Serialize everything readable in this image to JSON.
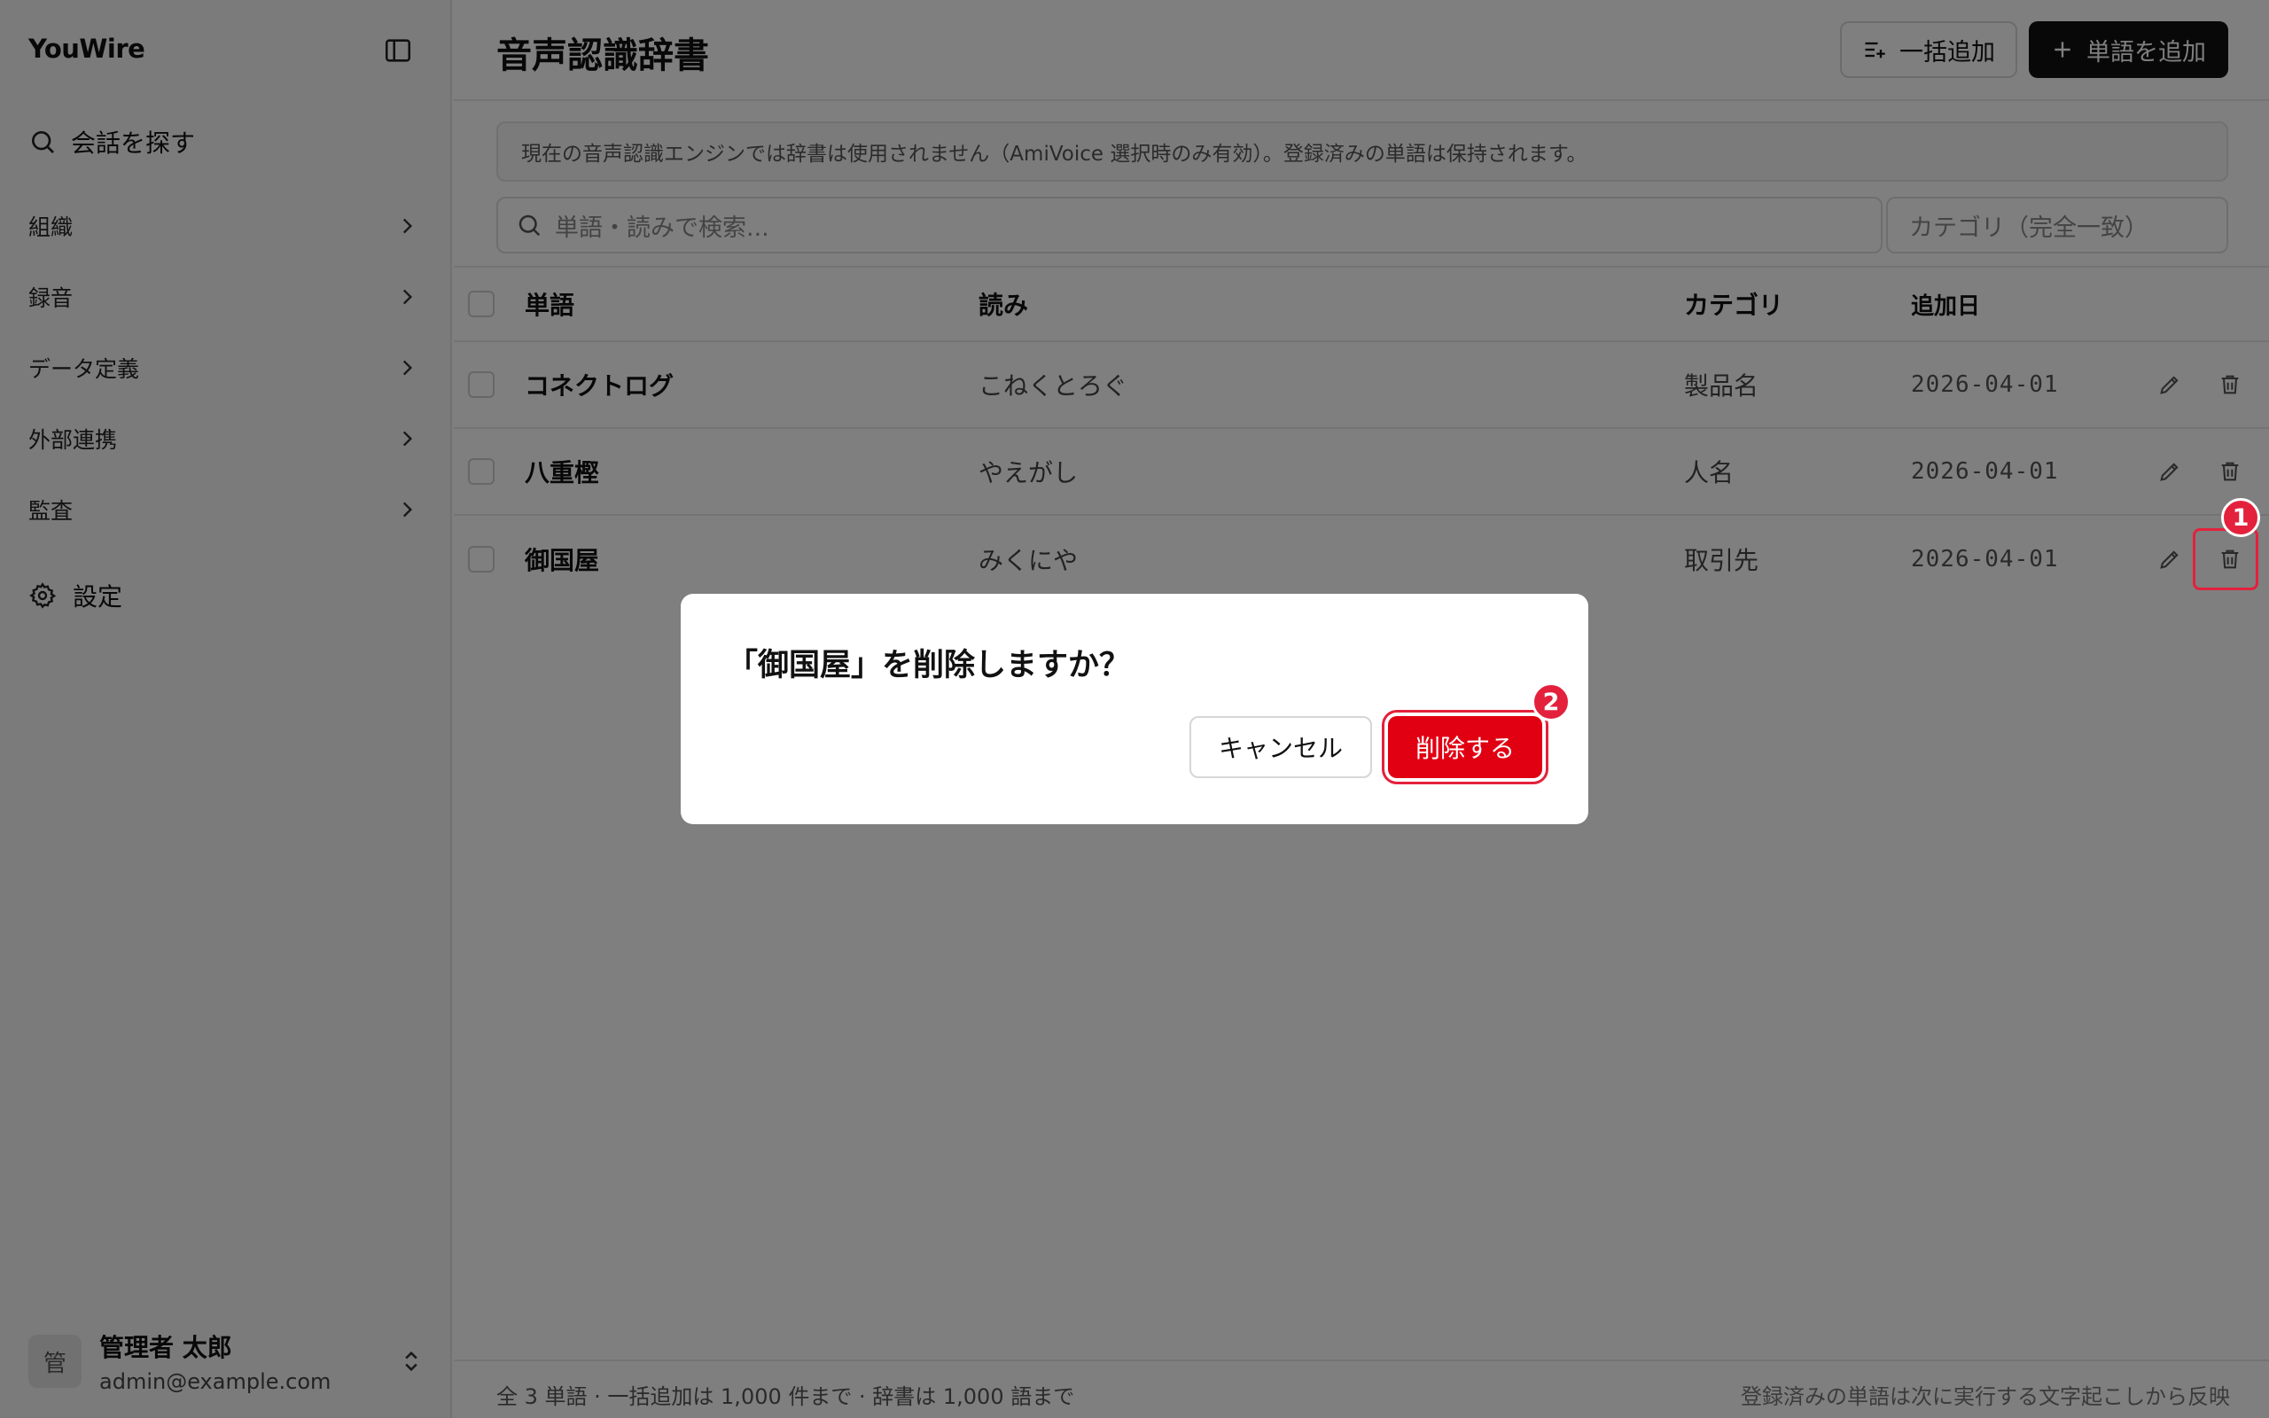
{
  "sidebar": {
    "brand": "YouWire",
    "search_label": "会話を探す",
    "groups": [
      {
        "label": "組織"
      },
      {
        "label": "録音"
      },
      {
        "label": "データ定義"
      },
      {
        "label": "外部連携"
      },
      {
        "label": "監査"
      }
    ],
    "settings_label": "設定",
    "user": {
      "avatar": "管",
      "name": "管理者 太郎",
      "email": "admin@example.com"
    }
  },
  "header": {
    "title": "音声認識辞書",
    "bulk_add_label": "一括追加",
    "add_word_label": "単語を追加"
  },
  "notice": "現在の音声認識エンジンでは辞書は使用されません（AmiVoice 選択時のみ有効）。登録済みの単語は保持されます。",
  "filters": {
    "search_placeholder": "単語・読みで検索...",
    "category_placeholder": "カテゴリ（完全一致）"
  },
  "table": {
    "columns": {
      "word": "単語",
      "reading": "読み",
      "category": "カテゴリ",
      "added": "追加日"
    },
    "rows": [
      {
        "word": "コネクトログ",
        "reading": "こねくとろぐ",
        "category": "製品名",
        "added": "2026-04-01"
      },
      {
        "word": "八重樫",
        "reading": "やえがし",
        "category": "人名",
        "added": "2026-04-01"
      },
      {
        "word": "御国屋",
        "reading": "みくにや",
        "category": "取引先",
        "added": "2026-04-01"
      }
    ]
  },
  "footer": {
    "left": "全 3 単語 · 一括追加は 1,000 件まで · 辞書は 1,000 語まで",
    "right": "登録済みの単語は次に実行する文字起こしから反映"
  },
  "dialog": {
    "title": "「御国屋」を削除しますか？",
    "cancel_label": "キャンセル",
    "delete_label": "削除する"
  },
  "annotations": {
    "marker1": "1",
    "marker2": "2"
  },
  "colors": {
    "accent_red": "#e10012",
    "marker_red": "#e3213c"
  }
}
